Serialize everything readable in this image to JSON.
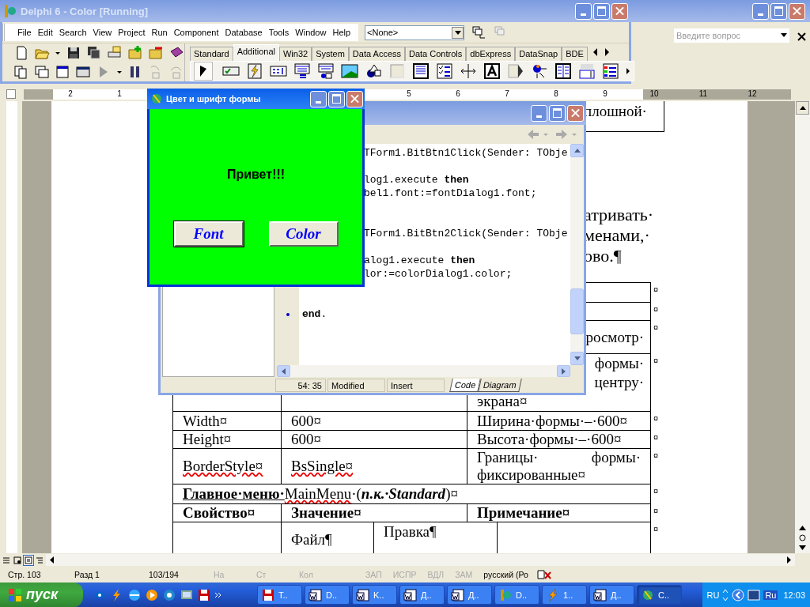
{
  "word": {
    "help_box": {
      "placeholder": "Введите вопрос"
    },
    "ruler": {
      "left_labels": [
        "2",
        "1"
      ],
      "right_labels": [
        "5",
        "6",
        "7",
        "8",
        "9",
        "10",
        "11",
        "12"
      ]
    },
    "box_fragment": "плошной·",
    "paragraph_lines": [
      "атривать·",
      "менами,·",
      "ово.¶"
    ],
    "table": {
      "rows": [
        {
          "kind": "standard",
          "mark": "¤",
          "cells": [
            {},
            {},
            {}
          ]
        },
        {
          "kind": "standard",
          "mark": "¤",
          "cells": [
            {},
            {},
            {}
          ]
        },
        {
          "kind": "standard",
          "mark": "¤",
          "cells": [
            {},
            {},
            {
              "lines": [
                "росмотр·"
              ]
            }
          ]
        },
        {
          "kind": "standard",
          "mark": "¤",
          "cells": [
            {},
            {},
            {
              "lines": [
                "формы·",
                "центру·",
                "экрана¤"
              ]
            }
          ]
        },
        {
          "kind": "standard",
          "mark": "¤",
          "cells": [
            {
              "lines": [
                "Width¤"
              ]
            },
            {
              "lines": [
                "600¤"
              ]
            },
            {
              "lines": [
                "Ширина·формы·–·600¤"
              ]
            }
          ]
        },
        {
          "kind": "standard",
          "mark": "¤",
          "cells": [
            {
              "lines": [
                "Height¤"
              ]
            },
            {
              "lines": [
                "600¤"
              ]
            },
            {
              "lines": [
                "Высота·формы·–·600¤"
              ]
            }
          ]
        },
        {
          "kind": "standard",
          "mark": "¤",
          "cells": [
            {
              "lines": [
                "BorderStyle¤"
              ],
              "spell_error": true
            },
            {
              "lines": [
                "BsSingle¤"
              ],
              "spell_error": true
            },
            {
              "lines": [
                "Границы· формы·",
                "фиксированные¤"
              ]
            }
          ]
        },
        {
          "kind": "merged",
          "mark": "¤",
          "segments": [
            {
              "text": "Главное·меню·",
              "bold": true,
              "underline": true
            },
            {
              "text": "MainMenu",
              "spell_error": true
            },
            {
              "text": "·("
            },
            {
              "text": "п.к.·Standard",
              "bold": true,
              "italic": true
            },
            {
              "text": ")¤"
            }
          ]
        },
        {
          "kind": "standard",
          "mark": "¤",
          "bold": true,
          "cells": [
            {
              "lines": [
                "Свойство¤"
              ]
            },
            {
              "lines": [
                "Значение¤"
              ]
            },
            {
              "lines": [
                "Примечание¤"
              ]
            }
          ]
        },
        {
          "kind": "split",
          "mark": "¤",
          "cells": [
            {},
            {
              "lines": [
                "Файл¶"
              ]
            },
            {
              "lines": [
                "Правка¶"
              ]
            },
            {}
          ]
        }
      ]
    },
    "status_bar": [
      {
        "text": "Стр. 103",
        "disabled": false
      },
      {
        "text": "Разд 1",
        "disabled": false
      },
      {
        "text": "103/194",
        "disabled": false
      },
      {
        "text": "На",
        "disabled": true
      },
      {
        "text": "Ст",
        "disabled": true
      },
      {
        "text": "Кол",
        "disabled": true
      },
      {
        "text": "ЗАП",
        "disabled": true
      },
      {
        "text": "ИСПР",
        "disabled": true
      },
      {
        "text": "ВДЛ",
        "disabled": true
      },
      {
        "text": "ЗАМ",
        "disabled": true
      },
      {
        "text": "русский (Ро",
        "disabled": false
      }
    ]
  },
  "delphi": {
    "title": "Delphi 6 - Color [Running]",
    "menu": [
      "File",
      "Edit",
      "Search",
      "View",
      "Project",
      "Run",
      "Component",
      "Database",
      "Tools",
      "Window",
      "Help"
    ],
    "combo": {
      "value": "<None>"
    },
    "palette_tabs": [
      {
        "label": "Standard",
        "selected": false
      },
      {
        "label": "Additional",
        "selected": true
      },
      {
        "label": "Win32",
        "selected": false
      },
      {
        "label": "System",
        "selected": false
      },
      {
        "label": "Data Access",
        "selected": false
      },
      {
        "label": "Data Controls",
        "selected": false
      },
      {
        "label": "dbExpress",
        "selected": false
      },
      {
        "label": "DataSnap",
        "selected": false
      },
      {
        "label": "BDE",
        "selected": false
      }
    ]
  },
  "code_window": {
    "lines": [
      {
        "kind": "clipped",
        "text": "TForm1.BitBtn1Click(Sender: TObje"
      },
      {
        "kind": "blank"
      },
      {
        "kind": "clipped",
        "text": "log1.execute **then**"
      },
      {
        "kind": "clipped",
        "text": "bel1.font:=fontDialog1.font;"
      },
      {
        "kind": "blank"
      },
      {
        "kind": "blank"
      },
      {
        "kind": "clipped",
        "text": "TForm1.BitBtn2Click(Sender: TObje"
      },
      {
        "kind": "blank"
      },
      {
        "kind": "clipped",
        "text": "alog1.execute **then**"
      },
      {
        "kind": "clipped",
        "text": "lor:=colorDialog1.color;"
      },
      {
        "kind": "blank"
      },
      {
        "kind": "blank"
      },
      {
        "kind": "full",
        "text": "**end**.",
        "marker": true
      }
    ],
    "status": [
      "54:  35",
      "Modified",
      "Insert"
    ],
    "tabs": [
      {
        "label": "Code",
        "selected": true
      },
      {
        "label": "Diagram",
        "selected": false
      }
    ]
  },
  "form_window": {
    "title": "Цвет и шрифт формы",
    "label": "Привет!!!",
    "buttons": [
      "Font",
      "Color"
    ]
  },
  "taskbar": {
    "start": "пуск",
    "tasks": [
      {
        "label": "T..",
        "selected": false
      },
      {
        "label": "D..",
        "selected": false
      },
      {
        "label": "K..",
        "selected": false
      },
      {
        "label": "Д..",
        "selected": false
      },
      {
        "label": "Д..",
        "selected": false
      },
      {
        "label": "D..",
        "selected": false
      },
      {
        "label": "1..",
        "selected": false
      },
      {
        "label": "Д..",
        "selected": false
      },
      {
        "label": "C..",
        "selected": true
      }
    ],
    "language": "RU",
    "layout": "Ru",
    "clock": "12:03"
  }
}
